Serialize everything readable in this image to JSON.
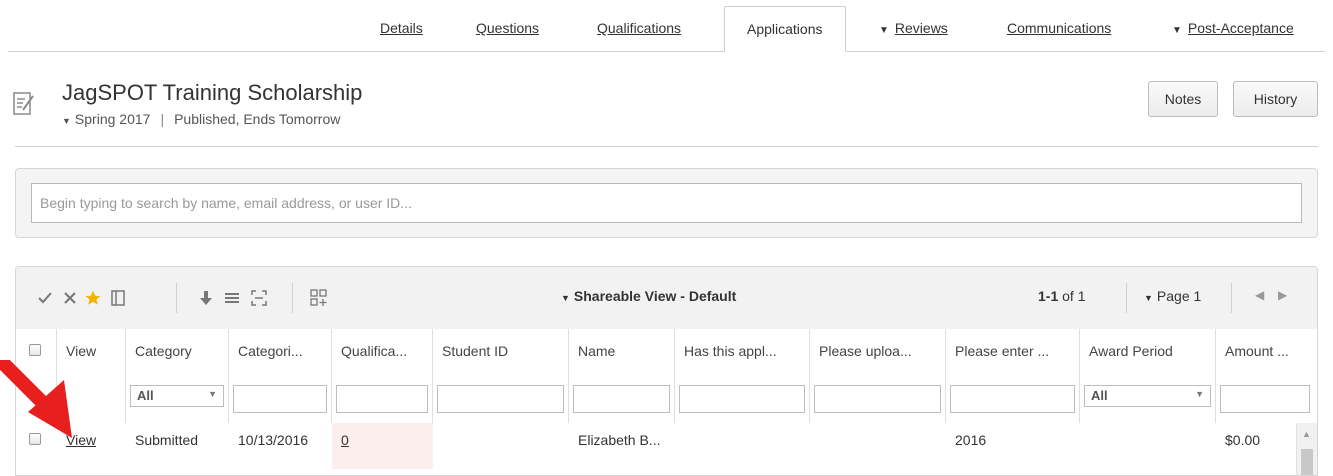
{
  "tabs": [
    {
      "label": "Details",
      "caret": false,
      "active": false
    },
    {
      "label": "Questions",
      "caret": false,
      "active": false
    },
    {
      "label": "Qualifications",
      "caret": false,
      "active": false
    },
    {
      "label": "Applications",
      "caret": false,
      "active": true
    },
    {
      "label": "Reviews",
      "caret": true,
      "active": false
    },
    {
      "label": "Communications",
      "caret": false,
      "active": false
    },
    {
      "label": "Post-Acceptance",
      "caret": true,
      "active": false
    }
  ],
  "header": {
    "title": "JagSPOT Training Scholarship",
    "term": "Spring 2017",
    "status": "Published, Ends Tomorrow",
    "separator": "|",
    "notes_label": "Notes",
    "history_label": "History"
  },
  "search": {
    "placeholder": "Begin typing to search by name, email address, or user ID..."
  },
  "toolbar": {
    "view_name": "Shareable View - Default",
    "range_bold": "1-1",
    "range_rest": " of 1",
    "page_label": "Page 1",
    "icons": [
      "check-icon",
      "x-icon",
      "star-icon",
      "columns-icon",
      "download-icon",
      "list-icon",
      "expand-icon",
      "add-widget-icon",
      "prev-arrow-icon",
      "next-arrow-icon"
    ]
  },
  "grid": {
    "columns": [
      "View",
      "Category",
      "Categori...",
      "Qualifica...",
      "Student ID",
      "Name",
      "Has this appl...",
      "Please uploa...",
      "Please enter ...",
      "Award Period",
      "Amount ..."
    ],
    "filters": {
      "category": "All",
      "award_period": "All"
    },
    "rows": [
      {
        "view": "View",
        "category": "Submitted",
        "date": "10/13/2016",
        "qualifications": "0",
        "student_id": "",
        "name": "Elizabeth B...",
        "has_applied": "",
        "please_upload": "",
        "please_enter": "2016",
        "award_period": "",
        "amount": "$0.00"
      }
    ]
  },
  "colors": {
    "accent_red": "#e81f1f",
    "qual_cell_bg": "#fdeeee",
    "star": "#f2b400"
  }
}
